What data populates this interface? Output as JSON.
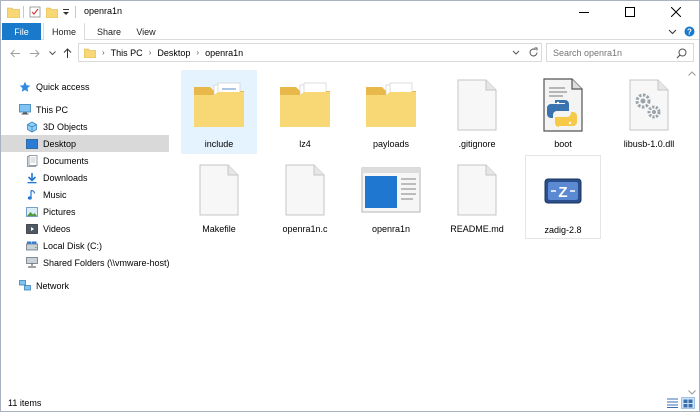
{
  "window": {
    "title": "openra1n"
  },
  "ribbon": {
    "tabs": [
      "File",
      "Home",
      "Share",
      "View"
    ]
  },
  "address": {
    "crumbs": [
      "This PC",
      "Desktop",
      "openra1n"
    ],
    "search_placeholder": "Search openra1n"
  },
  "nav": {
    "quick_access": "Quick access",
    "this_pc": "This PC",
    "items": [
      "3D Objects",
      "Desktop",
      "Documents",
      "Downloads",
      "Music",
      "Pictures",
      "Videos",
      "Local Disk (C:)",
      "Shared Folders (\\\\vmware-host) (Z"
    ],
    "network": "Network"
  },
  "files": [
    {
      "name": "include",
      "icon": "folder-icon"
    },
    {
      "name": "lz4",
      "icon": "folder-icon"
    },
    {
      "name": "payloads",
      "icon": "folder-icon"
    },
    {
      "name": ".gitignore",
      "icon": "file-icon"
    },
    {
      "name": "boot",
      "icon": "python-file-icon"
    },
    {
      "name": "libusb-1.0.dll",
      "icon": "dll-file-icon"
    },
    {
      "name": "Makefile",
      "icon": "file-icon"
    },
    {
      "name": "openra1n.c",
      "icon": "file-icon"
    },
    {
      "name": "openra1n",
      "icon": "executable-icon"
    },
    {
      "name": "README.md",
      "icon": "file-icon"
    },
    {
      "name": "zadig-2.8",
      "icon": "zadig-app-icon"
    }
  ],
  "status": {
    "count": "11 items"
  },
  "colors": {
    "accent": "#1979ca",
    "folder": "#f8d775",
    "selected_nav": "#d9d9d9",
    "selected_item": "#e5f3ff"
  }
}
